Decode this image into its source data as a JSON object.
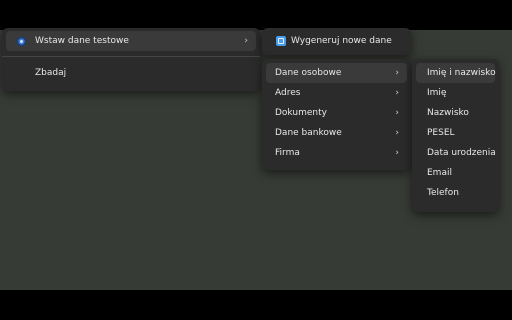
{
  "main_menu": {
    "insert_label": "Wstaw dane testowe",
    "inspect_label": "Zbadaj"
  },
  "submenu1": {
    "generate_label": "Wygeneruj nowe dane"
  },
  "submenu2": {
    "items": [
      "Dane osobowe",
      "Adres",
      "Dokumenty",
      "Dane bankowe",
      "Firma"
    ]
  },
  "submenu3": {
    "items": [
      "Imię i nazwisko",
      "Imię",
      "Nazwisko",
      "PESEL",
      "Data urodzenia",
      "Email",
      "Telefon"
    ]
  },
  "colors": {
    "desktop": "#373b35",
    "menu_bg": "#2b2b2b",
    "highlight": "#3a3a3a"
  }
}
